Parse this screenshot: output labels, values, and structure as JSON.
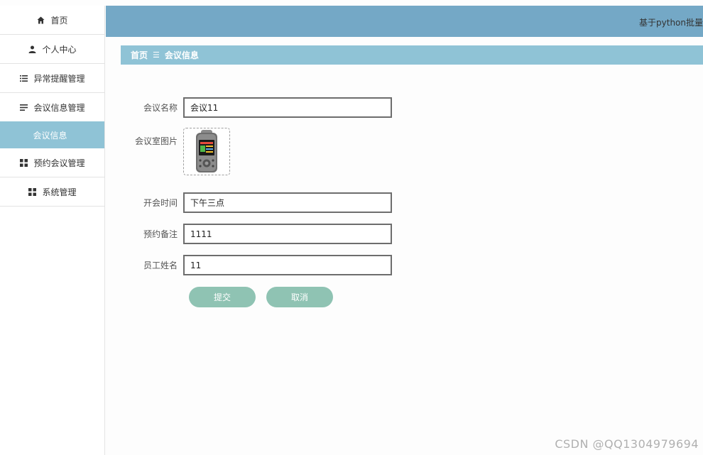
{
  "sidebar": {
    "items": [
      {
        "label": "首页",
        "icon": "home-icon"
      },
      {
        "label": "个人中心",
        "icon": "user-icon"
      },
      {
        "label": "异常提醒管理",
        "icon": "list-icon"
      },
      {
        "label": "会议信息管理",
        "icon": "menu-icon"
      },
      {
        "label": "会议信息",
        "icon": ""
      },
      {
        "label": "预约会议管理",
        "icon": "grid-icon"
      },
      {
        "label": "系统管理",
        "icon": "grid-icon"
      }
    ]
  },
  "header": {
    "title": "基于python批量"
  },
  "breadcrumb": {
    "home": "首页",
    "separator": "☰",
    "current": "会议信息"
  },
  "form": {
    "meeting_name": {
      "label": "会议名称",
      "value": "会议11"
    },
    "room_image": {
      "label": "会议室图片"
    },
    "meeting_time": {
      "label": "开会时间",
      "value": "下午三点"
    },
    "booking_note": {
      "label": "预约备注",
      "value": "1111"
    },
    "employee_name": {
      "label": "员工姓名",
      "value": "11"
    },
    "submit_label": "提交",
    "cancel_label": "取消"
  },
  "watermark": "CSDN @QQ1304979694",
  "colors": {
    "topbar": "#74a8c6",
    "accent": "#8fc3d6",
    "button": "#8fc3b3"
  }
}
